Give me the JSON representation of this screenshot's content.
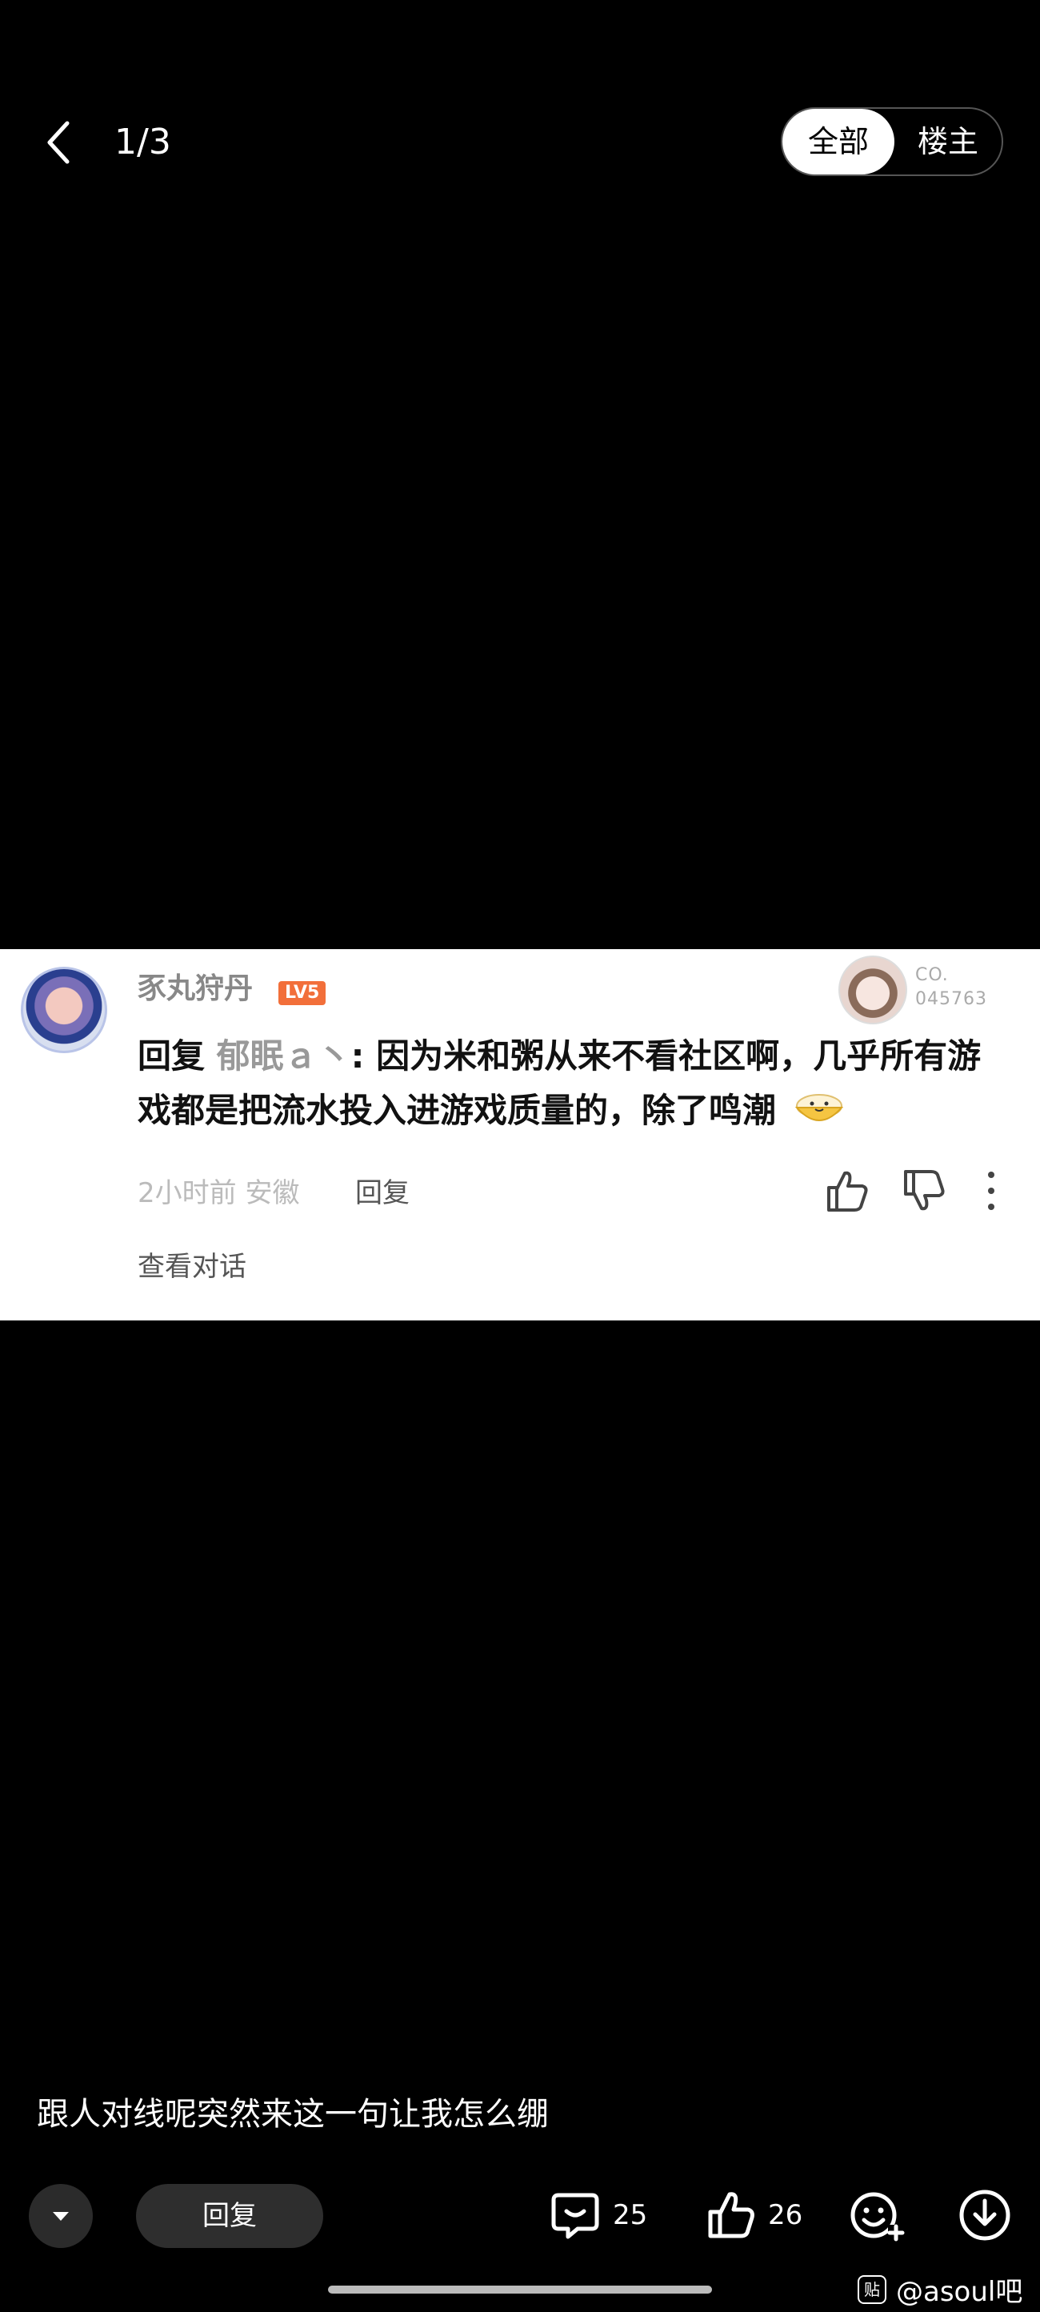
{
  "header": {
    "page_counter": "1/3",
    "filter_tabs": [
      {
        "label": "全部",
        "selected": true
      },
      {
        "label": "楼主",
        "selected": false
      }
    ]
  },
  "screenshot_card": {
    "username": "豕丸狩丹",
    "level_badge": "LV5",
    "fan_badge_code_line1": "CO.",
    "fan_badge_code_line2": "045763",
    "reply_prefix": "回复",
    "reply_target": "郁眠ａ丶",
    "comment_text": ": 因为米和粥从来不看社区啊，几乎所有游戏都是把流水投入进游戏质量的，除了鸣潮",
    "time_location": "2小时前 安徽",
    "reply_label": "回复",
    "view_conversation": "查看对话"
  },
  "caption": "跟人对线呢突然来这一句让我怎么绷",
  "bottom_bar": {
    "reply_label": "回复",
    "comment_count": "25",
    "like_count": "26"
  },
  "watermark": {
    "icon_text": "贴",
    "text": "@asoul吧"
  }
}
